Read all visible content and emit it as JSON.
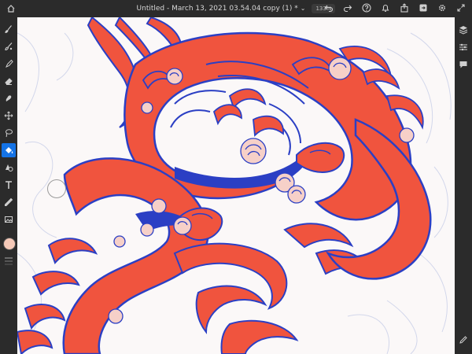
{
  "document": {
    "title": "Untitled - March 13, 2021 03.54.04 copy (1) *",
    "zoom": "133%"
  },
  "colors": {
    "chrome": "#2b2b2b",
    "active_tool": "#1473e6",
    "current_color": "#f5c9b8",
    "canvas_bg": "#fbf8f8",
    "art_red": "#f0543e",
    "art_blue": "#2b3fc4",
    "art_pink": "#f6d0c8"
  },
  "toolbar_left": [
    {
      "name": "pixel-brush-tool",
      "icon": "brush-icon"
    },
    {
      "name": "live-brush-tool",
      "icon": "watercolor-brush-icon"
    },
    {
      "name": "vector-brush-tool",
      "icon": "pen-brush-icon"
    },
    {
      "name": "eraser-tool",
      "icon": "eraser-icon"
    },
    {
      "name": "smudge-tool",
      "icon": "smudge-icon"
    },
    {
      "name": "transform-tool",
      "icon": "move-arrows-icon"
    },
    {
      "name": "lasso-tool",
      "icon": "lasso-icon"
    },
    {
      "name": "fill-tool",
      "icon": "paint-bucket-icon",
      "active": true
    },
    {
      "name": "shapes-tool",
      "icon": "shapes-icon"
    },
    {
      "name": "text-tool",
      "icon": "text-t-icon"
    },
    {
      "name": "eyedropper-tool",
      "icon": "eyedropper-icon"
    },
    {
      "name": "image-import-tool",
      "icon": "image-icon"
    }
  ],
  "toolbar_right": [
    "layers-icon",
    "layer-properties-icon",
    "comments-icon"
  ],
  "topbar_icons": [
    "undo-icon",
    "redo-icon",
    "help-icon",
    "notifications-icon",
    "share-icon",
    "export-icon",
    "settings-icon",
    "expand-icon"
  ]
}
